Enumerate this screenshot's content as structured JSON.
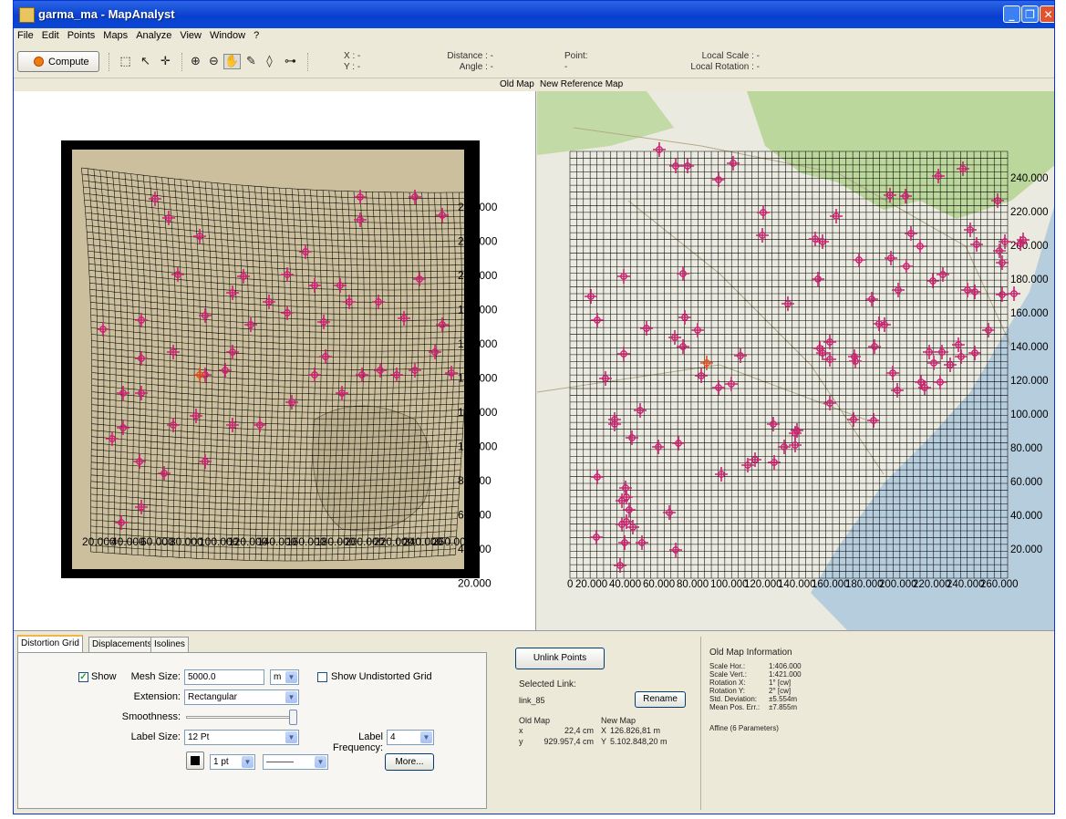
{
  "window": {
    "title": "garma_ma - MapAnalyst",
    "minimize": "_",
    "maximize": "❐",
    "close": "✕"
  },
  "menu": [
    "File",
    "Edit",
    "Points",
    "Maps",
    "Analyze",
    "View",
    "Window",
    "?"
  ],
  "toolbar": {
    "compute_label": "Compute",
    "x_label": "X : -",
    "y_label": "Y : -",
    "distance_label": "Distance : -",
    "angle_label": "Angle : -",
    "point_label": "Point:",
    "point_value": "-",
    "local_scale_label": "Local Scale : -",
    "local_rotation_label": "Local Rotation : -"
  },
  "panels": {
    "old_map_label": "Old Map",
    "new_map_label": "New Reference Map"
  },
  "old_map": {
    "right_labels": [
      "240.000",
      "220.000",
      "200.000",
      "180.000",
      "160.000",
      "140.000",
      "120.000",
      "100.000",
      "80.000",
      "60.000",
      "40.000",
      "20.000"
    ],
    "bottom_labels": [
      "20.000",
      "40.000",
      "60.000",
      "80.000",
      "100.000",
      "120.000",
      "140.000",
      "160.000",
      "180.000",
      "200.000",
      "220.000",
      "240.000",
      "260.000"
    ]
  },
  "new_map": {
    "right_labels": [
      "240.000",
      "220.000",
      "200.000",
      "180.000",
      "160.000",
      "140.000",
      "120.000",
      "100.000",
      "80.000",
      "60.000",
      "40.000",
      "20.000"
    ],
    "bottom_labels": [
      "0",
      "20.000",
      "40.000",
      "60.000",
      "80.000",
      "100.000",
      "120.000",
      "140.000",
      "160.000",
      "180.000",
      "200.000",
      "220.000",
      "240.000",
      "260.000"
    ]
  },
  "tabs": [
    "Distortion Grid",
    "Displacements",
    "Isolines"
  ],
  "distortion": {
    "show_label": "Show",
    "show_checked": true,
    "mesh_size_label": "Mesh Size:",
    "mesh_size_value": "5000.0",
    "mesh_unit": "m",
    "show_undistorted_label": "Show Undistorted Grid",
    "extension_label": "Extension:",
    "extension_value": "Rectangular",
    "smoothness_label": "Smoothness:",
    "smoothness_value": 1.0,
    "label_size_label": "Label Size:",
    "label_size_value": "12 Pt",
    "label_freq_label": "Label Frequency:",
    "label_freq_value": "4",
    "line_width_value": "1 pt",
    "line_style_value": "———",
    "more_label": "More..."
  },
  "link": {
    "unlink_label": "Unlink Points",
    "selected_link_label": "Selected Link:",
    "link_name": "link_85",
    "rename_label": "Rename",
    "old_map_header": "Old Map",
    "new_map_header": "New Map",
    "old_x_label": "x",
    "old_x": "22,4 cm",
    "old_y_label": "y",
    "old_y": "929.957,4 cm",
    "new_x_label": "X",
    "new_x": "126.826,81 m",
    "new_y_label": "Y",
    "new_y": "5.102.848,20 m"
  },
  "info": {
    "title": "Old Map Information",
    "rows": [
      {
        "label": "Scale Hor.:",
        "value": "1:406.000"
      },
      {
        "label": "Scale Vert.:",
        "value": "1:421.000"
      },
      {
        "label": "Rotation X:",
        "value": "1° [cw]"
      },
      {
        "label": "Rotation Y:",
        "value": "2° [cw]"
      },
      {
        "label": "Std. Deviation:",
        "value": "±5.554m"
      },
      {
        "label": "Mean Pos. Err.:",
        "value": "±7.855m"
      }
    ],
    "transform": "Affine (6 Parameters)"
  },
  "colors": {
    "marker": "#c8246e",
    "grid": "#000000",
    "sea": "#b6cddd",
    "forest": "#a6cf7d",
    "land": "#eae9df"
  }
}
